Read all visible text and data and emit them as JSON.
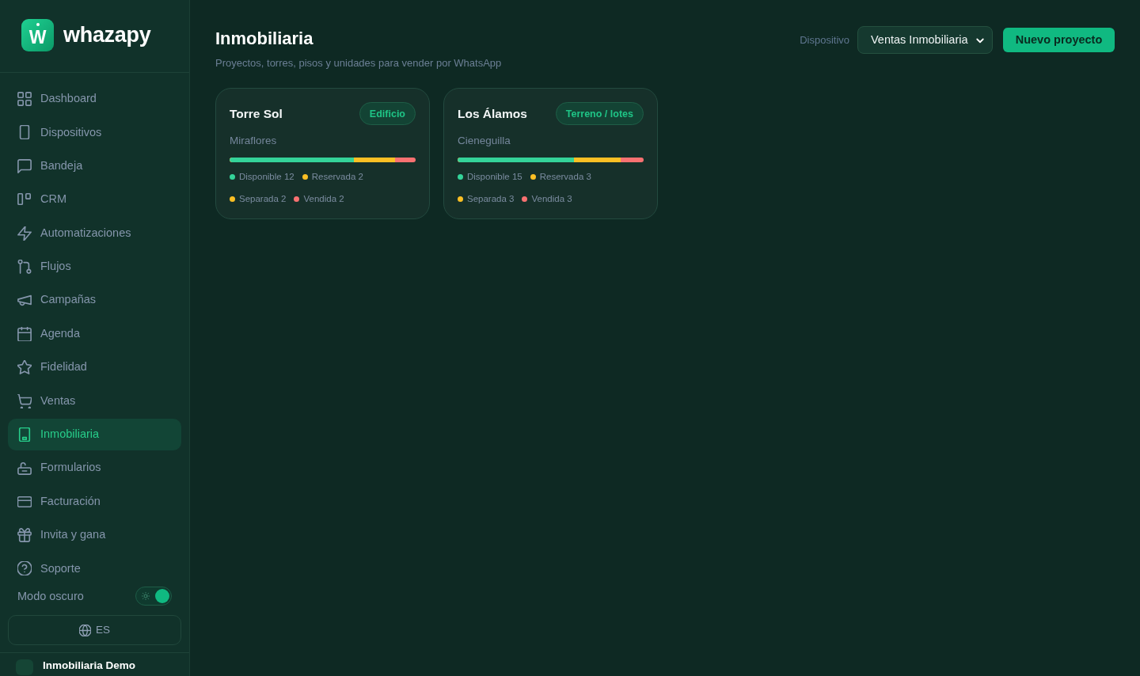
{
  "sidebar": {
    "logo_letter": "W",
    "brand": "whazapy",
    "nav": [
      {
        "label": "Dashboard",
        "selected": false
      },
      {
        "label": "Dispositivos",
        "selected": false
      },
      {
        "label": "Bandeja",
        "selected": false
      },
      {
        "label": "CRM",
        "selected": false
      },
      {
        "label": "Automatizaciones",
        "selected": false
      },
      {
        "label": "Flujos",
        "selected": false
      },
      {
        "label": "Campañas",
        "selected": false
      },
      {
        "label": "Agenda",
        "selected": false
      },
      {
        "label": "Fidelidad",
        "selected": false
      },
      {
        "label": "Ventas",
        "selected": false
      },
      {
        "label": "Inmobiliaria",
        "selected": true
      },
      {
        "label": "Formularios",
        "selected": false
      },
      {
        "label": "Facturación",
        "selected": false
      },
      {
        "label": "Invita y gana",
        "selected": false
      },
      {
        "label": "Soporte",
        "selected": false
      }
    ],
    "dark_mode": {
      "label": "Modo oscuro",
      "on": true
    },
    "language": "ES",
    "account": {
      "name": "Inmobiliaria Demo"
    }
  },
  "header": {
    "title": "Inmobiliaria",
    "subtitle": "Proyectos, torres, pisos y unidades para vender por WhatsApp",
    "device_label": "Dispositivo",
    "device": "Ventas Inmobiliaria",
    "new_button": "Nuevo proyecto"
  },
  "projects": [
    {
      "name": "Torre Sol",
      "type": "Edificio",
      "location": "Miraflores",
      "bar": {
        "color": "#f87171",
        "fills": [
          {
            "level": 0.667,
            "color": "#34d399"
          },
          {
            "level": 0.889,
            "color": "#fbbf24"
          }
        ]
      },
      "legend": [
        {
          "label": "Disponible 12",
          "color": "#34d399"
        },
        {
          "label": "Reservada 2",
          "color": "#fbbf24"
        },
        {
          "label": "Separada 2",
          "color": "#fbbf24"
        },
        {
          "label": "Vendida 2",
          "color": "#f87171"
        }
      ]
    },
    {
      "name": "Los Álamos",
      "type": "Terreno / lotes",
      "location": "Cieneguilla",
      "bar": {
        "color": "#f87171",
        "fills": [
          {
            "level": 0.625,
            "color": "#34d399"
          },
          {
            "level": 0.875,
            "color": "#fbbf24"
          }
        ]
      },
      "legend": [
        {
          "label": "Disponible 15",
          "color": "#34d399"
        },
        {
          "label": "Reservada 3",
          "color": "#fbbf24"
        },
        {
          "label": "Separada 3",
          "color": "#fbbf24"
        },
        {
          "label": "Vendida 3",
          "color": "#f87171"
        }
      ]
    }
  ]
}
